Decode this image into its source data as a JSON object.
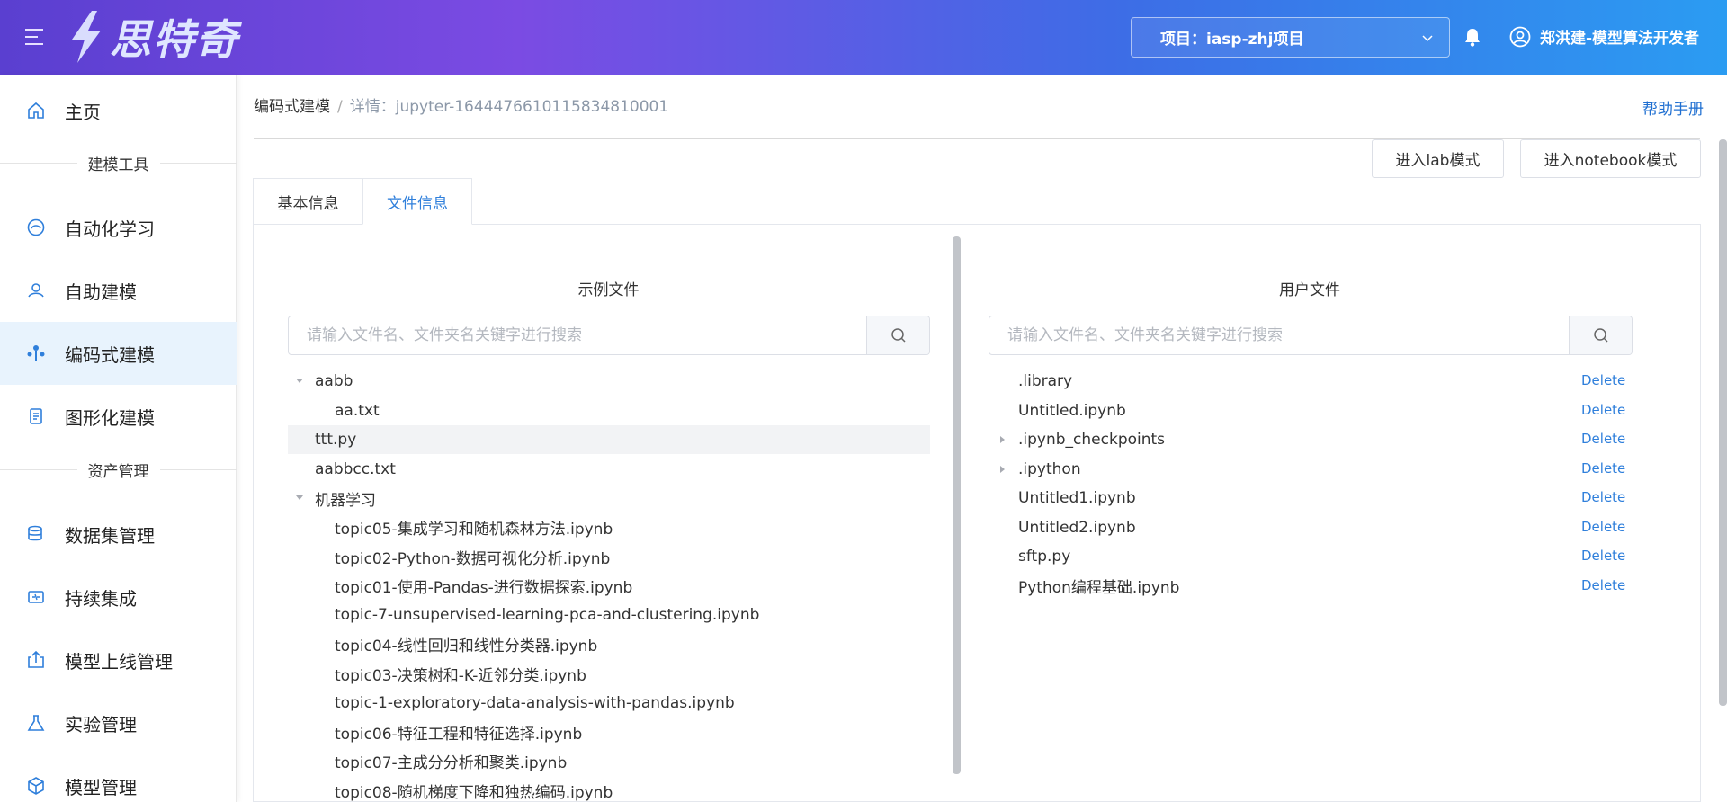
{
  "header": {
    "logo_text": "思特奇",
    "project_label": "项目：iasp-zhj项目",
    "user_name": "郑洪建-模型算法开发者"
  },
  "sidebar": {
    "home": "主页",
    "section_modeling": "建模工具",
    "items_modeling": [
      "自动化学习",
      "自助建模",
      "编码式建模",
      "图形化建模"
    ],
    "section_assets": "资产管理",
    "items_assets": [
      "数据集管理",
      "持续集成",
      "模型上线管理",
      "实验管理",
      "模型管理"
    ],
    "active": "编码式建模"
  },
  "breadcrumb": {
    "parent": "编码式建模",
    "separator": "/",
    "current": "详情：jupyter-1644476610115834810001"
  },
  "help_label": "帮助手册",
  "buttons": {
    "lab_mode": "进入lab模式",
    "notebook_mode": "进入notebook模式"
  },
  "tabs": [
    "基本信息",
    "文件信息"
  ],
  "active_tab": "文件信息",
  "example_panel": {
    "title": "示例文件",
    "search_placeholder": "请输入文件名、文件夹名关键字进行搜索",
    "tree": [
      {
        "label": "aabb",
        "caret": "expanded"
      },
      {
        "label": "aa.txt",
        "caret": ""
      },
      {
        "label": "ttt.py",
        "caret": "",
        "highlighted": true
      },
      {
        "label": "aabbcc.txt",
        "caret": ""
      },
      {
        "label": "机器学习",
        "caret": "expanded"
      },
      {
        "label": "topic05-集成学习和随机森林方法.ipynb",
        "caret": ""
      },
      {
        "label": "topic02-Python-数据可视化分析.ipynb",
        "caret": ""
      },
      {
        "label": "topic01-使用-Pandas-进行数据探索.ipynb",
        "caret": ""
      },
      {
        "label": "topic-7-unsupervised-learning-pca-and-clustering.ipynb",
        "caret": ""
      },
      {
        "label": "topic04-线性回归和线性分类器.ipynb",
        "caret": ""
      },
      {
        "label": "topic03-决策树和-K-近邻分类.ipynb",
        "caret": ""
      },
      {
        "label": "topic-1-exploratory-data-analysis-with-pandas.ipynb",
        "caret": ""
      },
      {
        "label": "topic06-特征工程和特征选择.ipynb",
        "caret": ""
      },
      {
        "label": "topic07-主成分分析和聚类.ipynb",
        "caret": ""
      },
      {
        "label": "topic08-随机梯度下降和独热编码.ipynb",
        "caret": ""
      }
    ]
  },
  "user_panel": {
    "title": "用户文件",
    "search_placeholder": "请输入文件名、文件夹名关键字进行搜索",
    "delete_label": "Delete",
    "files": [
      {
        "label": ".library",
        "caret": ""
      },
      {
        "label": "Untitled.ipynb",
        "caret": ""
      },
      {
        "label": ".ipynb_checkpoints",
        "caret": "collapsed"
      },
      {
        "label": ".ipython",
        "caret": "collapsed"
      },
      {
        "label": "Untitled1.ipynb",
        "caret": ""
      },
      {
        "label": "Untitled2.ipynb",
        "caret": ""
      },
      {
        "label": "sftp.py",
        "caret": ""
      },
      {
        "label": "Python编程基础.ipynb",
        "caret": ""
      }
    ]
  },
  "colors": {
    "accent": "#2f7fdb",
    "header_start": "#5a3fd0",
    "header_end": "#2b9cf2",
    "active_nav_bg": "#e8f3fd"
  }
}
